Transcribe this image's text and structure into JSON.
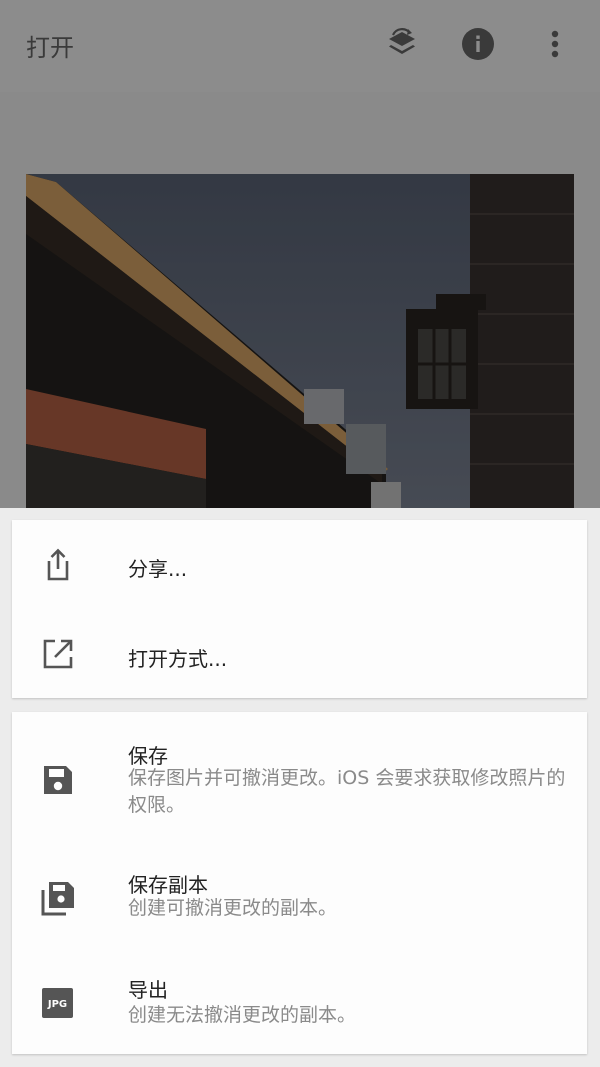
{
  "appbar": {
    "title": "打开",
    "icons": [
      "stack-swap-icon",
      "info-icon",
      "more-vert-icon"
    ]
  },
  "colors": {
    "scrim_bar": "#8c8c8c",
    "sheet_background": "#ececec",
    "card_background": "#fdfdfd",
    "primary_text": "#222222",
    "secondary_text": "#8a8a8a",
    "icon": "#555555"
  },
  "share_menu": {
    "share": {
      "label": "分享...",
      "icon": "share-icon"
    },
    "open_with": {
      "label": "打开方式...",
      "icon": "open-in-new-icon"
    }
  },
  "save_menu": {
    "save": {
      "label": "保存",
      "description": "保存图片并可撤消更改。iOS 会要求获取修改照片的权限。",
      "icon": "save-icon"
    },
    "save_copy": {
      "label": "保存副本",
      "description": "创建可撤消更改的副本。",
      "icon": "save-copy-icon"
    },
    "export": {
      "label": "导出",
      "description": "创建无法撤消更改的副本。",
      "icon": "jpg-icon",
      "badge": "JPG"
    }
  }
}
